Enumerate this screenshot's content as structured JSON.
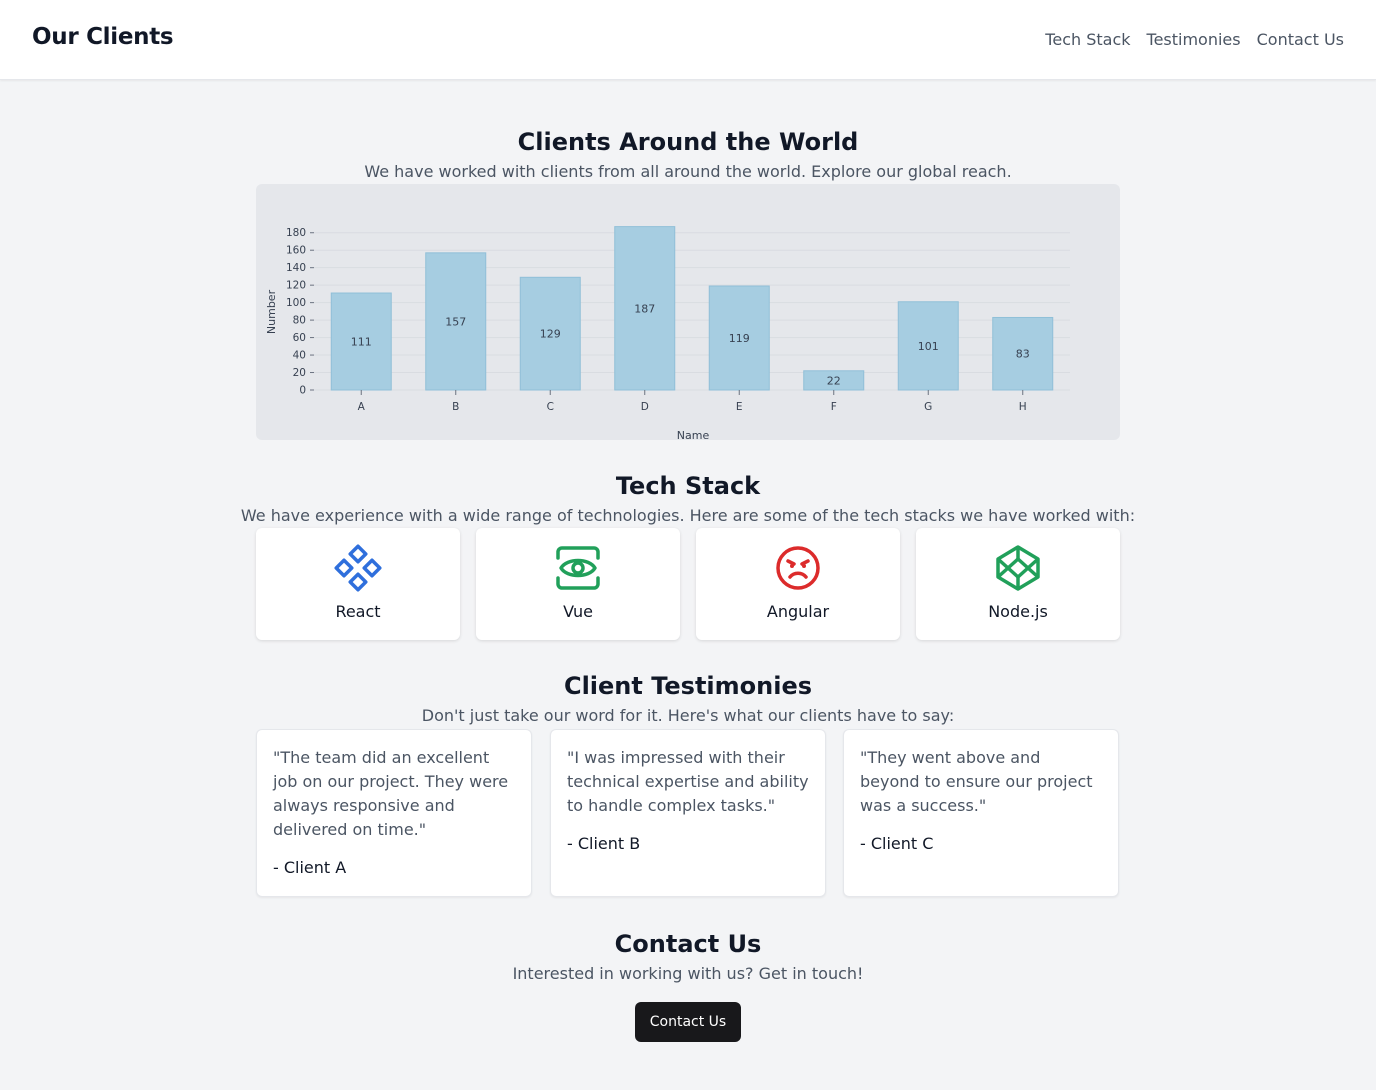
{
  "header": {
    "brand": "Our Clients",
    "nav": [
      "Tech Stack",
      "Testimonies",
      "Contact Us"
    ]
  },
  "clients": {
    "title": "Clients Around the World",
    "subtitle": "We have worked with clients from all around the world. Explore our global reach."
  },
  "chart_data": {
    "type": "bar",
    "categories": [
      "A",
      "B",
      "C",
      "D",
      "E",
      "F",
      "G",
      "H"
    ],
    "values": [
      111,
      157,
      129,
      187,
      119,
      22,
      101,
      83
    ],
    "xlabel": "Name",
    "ylabel": "Number",
    "yticks": [
      0,
      20,
      40,
      60,
      80,
      100,
      120,
      140,
      160,
      180
    ],
    "ylim": [
      0,
      190
    ],
    "bar_color": "#a6cde1",
    "grid": true
  },
  "tech": {
    "title": "Tech Stack",
    "subtitle": "We have experience with a wide range of technologies. Here are some of the tech stacks we have worked with:",
    "items": [
      {
        "label": "React",
        "icon": "react-diamonds-icon",
        "color": "#2f6fdc"
      },
      {
        "label": "Vue",
        "icon": "eye-icon",
        "color": "#21a05a"
      },
      {
        "label": "Angular",
        "icon": "angry-face-icon",
        "color": "#dc2b2b"
      },
      {
        "label": "Node.js",
        "icon": "codepen-cube-icon",
        "color": "#21a05a"
      }
    ]
  },
  "testimonies": {
    "title": "Client Testimonies",
    "subtitle": "Don't just take our word for it. Here's what our clients have to say:",
    "items": [
      {
        "quote": "\"The team did an excellent job on our project. They were always responsive and delivered on time.\"",
        "author": "- Client A"
      },
      {
        "quote": "\"I was impressed with their technical expertise and ability to handle complex tasks.\"",
        "author": "- Client B"
      },
      {
        "quote": "\"They went above and beyond to ensure our project was a success.\"",
        "author": "- Client C"
      }
    ]
  },
  "contact": {
    "title": "Contact Us",
    "subtitle": "Interested in working with us? Get in touch!",
    "button": "Contact Us"
  }
}
